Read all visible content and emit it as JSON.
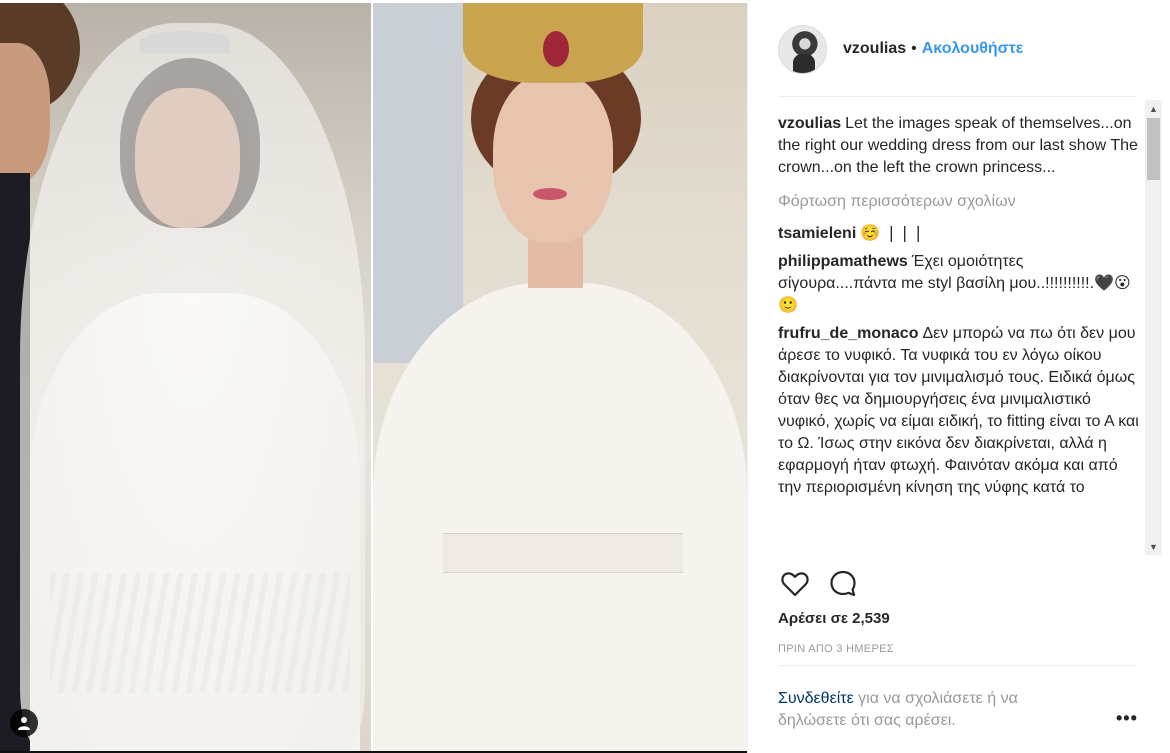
{
  "header": {
    "username": "vzoulias",
    "separator": "•",
    "follow_label": "Ακολουθήστε"
  },
  "caption": {
    "username": "vzoulias",
    "text": "Let the images speak of themselves...on the right our wedding dress from our last show The crown...on the left the crown princess..."
  },
  "load_more_label": "Φόρτωση περισσότερων σχολίων",
  "comments": [
    {
      "username": "tsamieleni",
      "text": "☺️ ❘❘❘"
    },
    {
      "username": "philippamathews",
      "text": "Έχει ομοιότητες σίγουρα....πάντα me styl βασίλη μου..!!!!!!!!!!.🖤😮🙂"
    },
    {
      "username": "frufru_de_monaco",
      "text": "Δεν μπορώ να πω ότι δεν μου άρεσε το νυφικό. Τα νυφικά του εν λόγω οίκου διακρίνονται για τον μινιμαλισμό τους. Ειδικά όμως όταν θες να δημιουργήσεις ένα μινιμαλιστικό νυφικό, χωρίς να είμαι ειδική, το fitting είναι το Α και το Ω. Ίσως στην εικόνα δεν διακρίνεται, αλλά η εφαρμογή ήταν φτωχή. Φαινόταν ακόμα και από την περιορισμένη κίνηση της νύφης κατά το"
    }
  ],
  "likes_label": "Αρέσει σε 2,539",
  "timestamp": "ΠΡΙΝ ΑΠΟ 3 ΗΜΕΡΕΣ",
  "footer": {
    "login_link": "Συνδεθείτε",
    "login_rest": " για να σχολιάσετε ή να δηλώσετε ότι σας αρέσει.",
    "more_options": "•••"
  },
  "icons": {
    "like": "heart-icon",
    "comment": "speech-bubble-icon",
    "user_tag": "user-icon"
  },
  "colors": {
    "link": "#3897f0",
    "secondary_text": "#999999",
    "login_link": "#003569"
  }
}
